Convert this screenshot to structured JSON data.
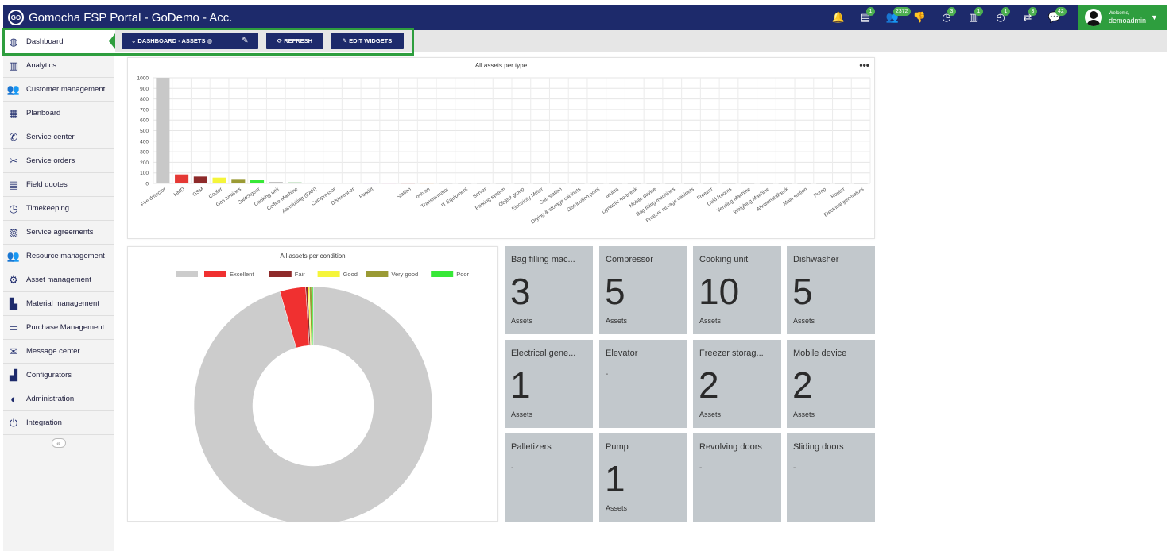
{
  "app": {
    "title": "Gomocha FSP Portal - GoDemo - Acc.",
    "logo_text": "GO"
  },
  "header": {
    "icons": [
      {
        "name": "bell-icon",
        "glyph": "🔔",
        "badge": ""
      },
      {
        "name": "document-icon",
        "glyph": "▤",
        "badge": "1"
      },
      {
        "name": "users-icon",
        "glyph": "👥",
        "badge": "2372"
      },
      {
        "name": "thumbs-down-icon",
        "glyph": "👎",
        "badge": ""
      },
      {
        "name": "clock-icon",
        "glyph": "◷",
        "badge": "3"
      },
      {
        "name": "board-icon",
        "glyph": "▥",
        "badge": "1"
      },
      {
        "name": "timer-icon",
        "glyph": "◴",
        "badge": "1"
      },
      {
        "name": "exchange-icon",
        "glyph": "⇄",
        "badge": "3"
      },
      {
        "name": "chat-icon",
        "glyph": "💬",
        "badge": "42"
      }
    ],
    "user": {
      "welcome": "Welcome,",
      "name": "demoadmin"
    }
  },
  "sidebar": {
    "items": [
      {
        "label": "Dashboard",
        "icon": "◍",
        "name": "dashboard"
      },
      {
        "label": "Analytics",
        "icon": "▥",
        "name": "analytics"
      },
      {
        "label": "Customer management",
        "icon": "👥",
        "name": "customer-management"
      },
      {
        "label": "Planboard",
        "icon": "▦",
        "name": "planboard"
      },
      {
        "label": "Service center",
        "icon": "✆",
        "name": "service-center"
      },
      {
        "label": "Service orders",
        "icon": "✂",
        "name": "service-orders"
      },
      {
        "label": "Field quotes",
        "icon": "▤",
        "name": "field-quotes"
      },
      {
        "label": "Timekeeping",
        "icon": "◷",
        "name": "timekeeping"
      },
      {
        "label": "Service agreements",
        "icon": "▧",
        "name": "service-agreements"
      },
      {
        "label": "Resource management",
        "icon": "👥",
        "name": "resource-management"
      },
      {
        "label": "Asset management",
        "icon": "⚙",
        "name": "asset-management"
      },
      {
        "label": "Material management",
        "icon": "▙",
        "name": "material-management"
      },
      {
        "label": "Purchase Management",
        "icon": "▭",
        "name": "purchase-management"
      },
      {
        "label": "Message center",
        "icon": "✉",
        "name": "message-center"
      },
      {
        "label": "Configurators",
        "icon": "▟",
        "name": "configurators"
      },
      {
        "label": "Administration",
        "icon": "◐",
        "name": "administration"
      },
      {
        "label": "Integration",
        "icon": "⏻",
        "name": "integration"
      }
    ],
    "collapse_label": "«"
  },
  "toolbar": {
    "dashboard_select": "⌄  DASHBOARD - ASSETS ◍",
    "edit_icon": "✎",
    "refresh": "⟳ REFRESH",
    "edit_widgets": "✎ EDIT WIDGETS"
  },
  "colors": {
    "nav_blue": "#1d2a6b",
    "accent_green": "#2e9e3e",
    "tile_gray": "#c2c8cc"
  },
  "bar_chart": {
    "more_label": "•••",
    "chart_data": {
      "type": "bar",
      "title": "All assets per type",
      "ylim": [
        0,
        1000
      ],
      "yticks": [
        0,
        100,
        200,
        300,
        400,
        500,
        600,
        700,
        800,
        900,
        1000
      ],
      "grid": true,
      "categories": [
        "Fire detector",
        "HMD",
        "GSM",
        "Cooler",
        "Gas turbines",
        "Switchgear",
        "Cooking unit",
        "Coffee Machine",
        "Aansluiting (EAN)",
        "Compressor",
        "Dishwasher",
        "Forklift",
        "",
        "Station",
        "ontvan",
        "Transformator",
        "IT Equipment",
        "Server",
        "Parking system",
        "Object group",
        "Electricity Meter",
        "Sub station",
        "Drying & storage cabinets",
        "Distribution point",
        "aruida",
        "Dynamic no-break",
        "Mobile device",
        "Bag filling machines",
        "Freezer storage cabinets",
        "Freezer",
        "Cold Rooms",
        "Vending Machine",
        "Weighing Machine",
        "Afvalsinstallaark",
        "Main station",
        "Pump",
        "Router",
        "Electrical generators"
      ],
      "values": [
        1000,
        85,
        65,
        55,
        35,
        30,
        12,
        10,
        8,
        7,
        6,
        5,
        5,
        4,
        4,
        3,
        3,
        3,
        3,
        3,
        3,
        3,
        3,
        3,
        3,
        2,
        2,
        2,
        2,
        2,
        2,
        2,
        2,
        2,
        2,
        2,
        2,
        2
      ],
      "colors": [
        "#c8c8c8",
        "#e53935",
        "#8e2a2a",
        "#f5f53a",
        "#9a9a34",
        "#36e836",
        "#9a9a9a",
        "#78b878",
        "#c8e8f0",
        "#9ec8d8",
        "#9aa8d8",
        "#c8a8d8",
        "#e8b8d8",
        "#d8a8a8",
        "#e8c8a8",
        "#c8c8c8",
        "#c8c8c8",
        "#c8c8c8",
        "#c8c8c8",
        "#c8c8c8",
        "#c8c8c8",
        "#c8c8c8",
        "#c8c8c8",
        "#c8c8c8",
        "#c8c8c8",
        "#c8c8c8",
        "#c8c8c8",
        "#c8c8c8",
        "#c8c8c8",
        "#c8c8c8",
        "#c8c8c8",
        "#c8c8c8",
        "#c8c8c8",
        "#c8c8c8",
        "#c8c8c8",
        "#c8c8c8",
        "#c8c8c8",
        "#c8c8c8"
      ]
    }
  },
  "donut_chart": {
    "chart_data": {
      "type": "pie",
      "title": "All assets per condition",
      "legend_position": "top",
      "categories": [
        "",
        "Excellent",
        "Fair",
        "Good",
        "Very good",
        "Poor"
      ],
      "values": [
        95.5,
        3.5,
        0.3,
        0.2,
        0.3,
        0.2
      ],
      "colors": [
        "#cccccc",
        "#f03030",
        "#8e2a2a",
        "#f5f53a",
        "#9a9a34",
        "#36e836"
      ]
    }
  },
  "tiles": [
    {
      "name": "Bag filling mac...",
      "count": "3",
      "unit": "Assets"
    },
    {
      "name": "Compressor",
      "count": "5",
      "unit": "Assets"
    },
    {
      "name": "Cooking unit",
      "count": "10",
      "unit": "Assets"
    },
    {
      "name": "Dishwasher",
      "count": "5",
      "unit": "Assets"
    },
    {
      "name": "Electrical gene...",
      "count": "1",
      "unit": "Assets"
    },
    {
      "name": "Elevator",
      "dash": "-"
    },
    {
      "name": "Freezer storag...",
      "count": "2",
      "unit": "Assets"
    },
    {
      "name": "Mobile device",
      "count": "2",
      "unit": "Assets"
    },
    {
      "name": "Palletizers",
      "dash": "-"
    },
    {
      "name": "Pump",
      "count": "1",
      "unit": "Assets"
    },
    {
      "name": "Revolving doors",
      "dash": "-"
    },
    {
      "name": "Sliding doors",
      "dash": "-"
    }
  ]
}
